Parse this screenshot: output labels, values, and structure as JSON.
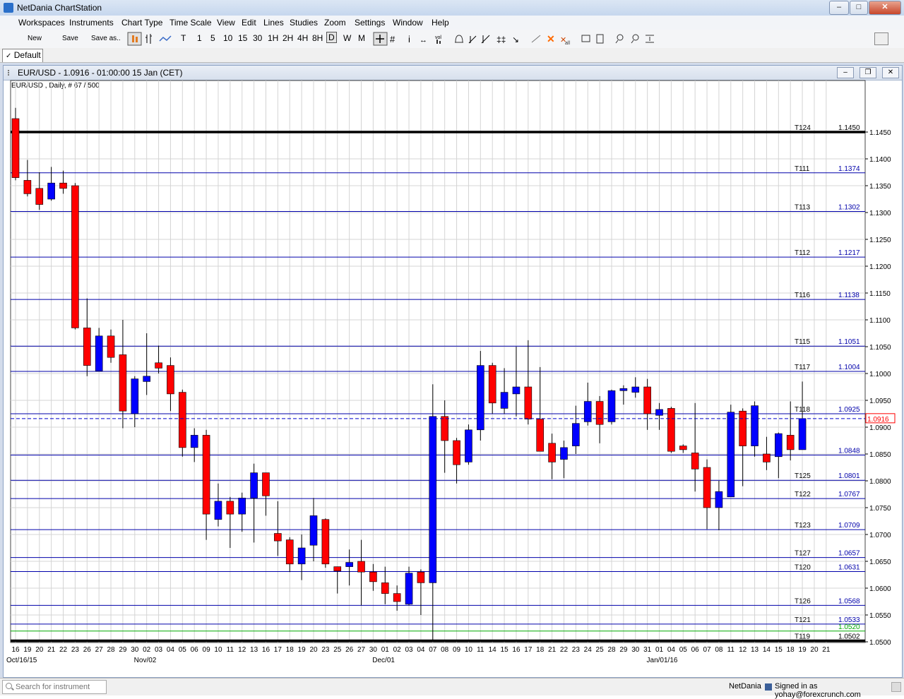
{
  "app": {
    "title": "NetDania ChartStation"
  },
  "window_controls": {
    "minimize": "–",
    "maximize": "□",
    "close": "✕"
  },
  "menu": [
    "Workspaces",
    "Instruments",
    "Chart Type",
    "Time Scale",
    "View",
    "Edit",
    "Lines",
    "Studies",
    "Zoom",
    "Settings",
    "Window",
    "Help"
  ],
  "toolbar": {
    "new": "New",
    "save": "Save",
    "save_as": "Save as..",
    "timeframes": [
      "T",
      "1",
      "5",
      "10",
      "15",
      "30",
      "1H",
      "2H",
      "4H",
      "8H",
      "D",
      "W",
      "M"
    ],
    "selected_timeframe": "D"
  },
  "tab": {
    "label": "Default"
  },
  "chart_window": {
    "title": "EUR/USD - 1.0916 - 01:00:00  15 Jan (CET)",
    "info": "EUR/USD , Daily, # 67 / 500"
  },
  "status": {
    "search_placeholder": "Search for instrument",
    "provider": "NetDania",
    "signed_in": "Signed in as yohay@forexcrunch.com"
  },
  "colors": {
    "up": "#0000ff",
    "down": "#ff0000",
    "line": "#0000aa",
    "accent_green": "#00aa00"
  },
  "chart_data": {
    "type": "candlestick",
    "symbol": "EUR/USD",
    "ylim": [
      1.05,
      1.15
    ],
    "yticks": [
      1.05,
      1.055,
      1.06,
      1.065,
      1.07,
      1.075,
      1.08,
      1.085,
      1.09,
      1.095,
      1.1,
      1.105,
      1.11,
      1.115,
      1.12,
      1.125,
      1.13,
      1.135,
      1.14,
      1.145
    ],
    "last_price": "1.0916",
    "xlabels": [
      "16",
      "19",
      "20",
      "21",
      "22",
      "23",
      "26",
      "27",
      "28",
      "29",
      "30",
      "02",
      "03",
      "04",
      "05",
      "06",
      "09",
      "10",
      "11",
      "12",
      "13",
      "16",
      "17",
      "18",
      "19",
      "20",
      "23",
      "25",
      "26",
      "27",
      "30",
      "01",
      "02",
      "03",
      "04",
      "07",
      "08",
      "09",
      "10",
      "11",
      "14",
      "15",
      "16",
      "17",
      "18",
      "21",
      "22",
      "23",
      "24",
      "25",
      "28",
      "29",
      "30",
      "31",
      "01",
      "04",
      "05",
      "06",
      "07",
      "08",
      "11",
      "12",
      "13",
      "14",
      "15",
      "18",
      "19",
      "20",
      "21"
    ],
    "major_labels": [
      {
        "text": "Oct/16/15",
        "index": 0
      },
      {
        "text": "Nov/02",
        "index": 11
      },
      {
        "text": "Dec/01",
        "index": 31
      },
      {
        "text": "Jan/01/16",
        "index": 54
      }
    ],
    "candles": [
      [
        1.1475,
        1.1495,
        1.136,
        1.1365
      ],
      [
        1.136,
        1.1398,
        1.133,
        1.1335
      ],
      [
        1.1345,
        1.1375,
        1.1305,
        1.1315
      ],
      [
        1.1325,
        1.1385,
        1.1322,
        1.1355
      ],
      [
        1.1355,
        1.1378,
        1.1335,
        1.1345
      ],
      [
        1.135,
        1.1355,
        1.1082,
        1.1085
      ],
      [
        1.1085,
        1.114,
        1.0995,
        1.1015
      ],
      [
        1.1005,
        1.1085,
        1.1005,
        1.107
      ],
      [
        1.107,
        1.1082,
        1.102,
        1.103
      ],
      [
        1.1035,
        1.11,
        1.0898,
        1.093
      ],
      [
        1.0925,
        1.0995,
        1.09,
        1.099
      ],
      [
        1.0985,
        1.1075,
        1.096,
        1.0995
      ],
      [
        1.102,
        1.1052,
        1.1,
        1.101
      ],
      [
        1.1015,
        1.103,
        1.093,
        1.0962
      ],
      [
        1.0965,
        1.097,
        1.0845,
        1.0862
      ],
      [
        1.0862,
        1.0898,
        1.0835,
        1.0885
      ],
      [
        1.0885,
        1.0895,
        1.069,
        1.0738
      ],
      [
        1.0728,
        1.0795,
        1.0715,
        1.0762
      ],
      [
        1.0762,
        1.077,
        1.0675,
        1.0738
      ],
      [
        1.0738,
        1.0778,
        1.0705,
        1.0768
      ],
      [
        1.0768,
        1.0832,
        1.0685,
        1.0815
      ],
      [
        1.0815,
        1.0815,
        1.0735,
        1.0772
      ],
      [
        1.0702,
        1.0762,
        1.066,
        1.0688
      ],
      [
        1.069,
        1.0695,
        1.063,
        1.0645
      ],
      [
        1.0645,
        1.07,
        1.0615,
        1.0675
      ],
      [
        1.068,
        1.0768,
        1.065,
        1.0735
      ],
      [
        1.0728,
        1.073,
        1.0638,
        1.0645
      ],
      [
        1.064,
        1.064,
        1.059,
        1.0632
      ],
      [
        1.064,
        1.0672,
        1.0605,
        1.0648
      ],
      [
        1.065,
        1.069,
        1.0568,
        1.063
      ],
      [
        1.063,
        1.0645,
        1.0595,
        1.0612
      ],
      [
        1.061,
        1.064,
        1.057,
        1.059
      ],
      [
        1.059,
        1.0605,
        1.0558,
        1.0575
      ],
      [
        1.057,
        1.064,
        1.0568,
        1.0628
      ],
      [
        1.063,
        1.0635,
        1.055,
        1.061
      ],
      [
        1.061,
        1.098,
        1.05,
        1.092
      ],
      [
        1.092,
        1.095,
        1.0815,
        1.0875
      ],
      [
        1.0875,
        1.088,
        1.0795,
        1.083
      ],
      [
        1.0835,
        1.0905,
        1.083,
        1.0895
      ],
      [
        1.0895,
        1.1042,
        1.0875,
        1.1015
      ],
      [
        1.1015,
        1.102,
        1.0925,
        1.0945
      ],
      [
        1.0935,
        1.101,
        1.0925,
        1.0965
      ],
      [
        1.0962,
        1.105,
        1.092,
        1.0975
      ],
      [
        1.0975,
        1.1062,
        1.0905,
        1.0915
      ],
      [
        1.0915,
        1.1012,
        1.0865,
        1.0855
      ],
      [
        1.087,
        1.0888,
        1.0803,
        1.0835
      ],
      [
        1.084,
        1.0875,
        1.0805,
        1.0862
      ],
      [
        1.0865,
        1.094,
        1.085,
        1.0907
      ],
      [
        1.091,
        1.0983,
        1.0903,
        1.0948
      ],
      [
        1.0948,
        1.0958,
        1.087,
        1.0905
      ],
      [
        1.091,
        1.097,
        1.0905,
        1.0968
      ],
      [
        1.0968,
        1.0978,
        1.0942,
        1.0972
      ],
      [
        1.0965,
        1.0993,
        1.0955,
        1.0975
      ],
      [
        1.0975,
        1.099,
        1.0895,
        1.0925
      ],
      [
        1.0922,
        1.0945,
        1.0895,
        1.0933
      ],
      [
        1.0935,
        1.0938,
        1.0852,
        1.0855
      ],
      [
        1.0865,
        1.0868,
        1.0852,
        1.0858
      ],
      [
        1.0852,
        1.0945,
        1.078,
        1.0822
      ],
      [
        1.0825,
        1.084,
        1.071,
        1.075
      ],
      [
        1.075,
        1.08,
        1.0708,
        1.078
      ],
      [
        1.077,
        1.0942,
        1.077,
        1.0928
      ],
      [
        1.093,
        1.0935,
        1.079,
        1.0865
      ],
      [
        1.0865,
        1.0948,
        1.0845,
        1.094
      ],
      [
        1.085,
        1.0882,
        1.082,
        1.0835
      ],
      [
        1.0845,
        1.089,
        1.0805,
        1.0888
      ],
      [
        1.0885,
        1.0948,
        1.0838,
        1.0858
      ],
      [
        1.0858,
        1.0985,
        1.0858,
        1.0916
      ]
    ],
    "lines": [
      {
        "label": "T124",
        "value": 1.145,
        "text": "1.1450",
        "style": "thick"
      },
      {
        "label": "T111",
        "value": 1.1374,
        "text": "1.1374"
      },
      {
        "label": "T113",
        "value": 1.1302,
        "text": "1.1302"
      },
      {
        "label": "T112",
        "value": 1.1217,
        "text": "1.1217"
      },
      {
        "label": "T116",
        "value": 1.1138,
        "text": "1.1138"
      },
      {
        "label": "T115",
        "value": 1.1051,
        "text": "1.1051"
      },
      {
        "label": "T117",
        "value": 1.1004,
        "text": "1.1004"
      },
      {
        "label": "T118",
        "value": 1.0925,
        "text": "1.0925"
      },
      {
        "label": "",
        "value": 1.0848,
        "text": "1.0848"
      },
      {
        "label": "T125",
        "value": 1.0801,
        "text": "1.0801"
      },
      {
        "label": "T122",
        "value": 1.0767,
        "text": "1.0767"
      },
      {
        "label": "T123",
        "value": 1.0709,
        "text": "1.0709"
      },
      {
        "label": "T127",
        "value": 1.0657,
        "text": "1.0657"
      },
      {
        "label": "T120",
        "value": 1.0631,
        "text": "1.0631"
      },
      {
        "label": "T126",
        "value": 1.0568,
        "text": "1.0568"
      },
      {
        "label": "T121",
        "value": 1.0533,
        "text": "1.0533"
      },
      {
        "label": "",
        "value": 1.052,
        "text": "1.0520",
        "style": "green"
      },
      {
        "label": "T119",
        "value": 1.0502,
        "text": "1.0502",
        "style": "thick"
      }
    ]
  }
}
